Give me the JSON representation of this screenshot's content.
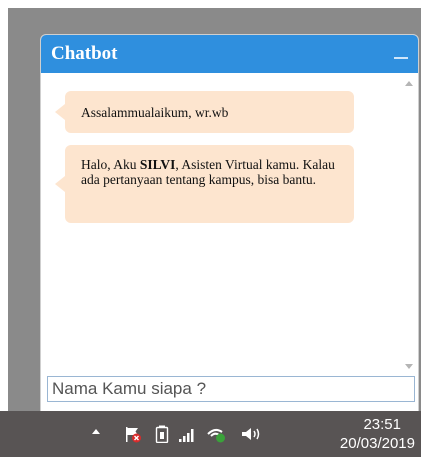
{
  "chatbot": {
    "title": "Chatbot",
    "messages": [
      {
        "text_before": "Assalammualaikum, wr.wb",
        "bold": "",
        "text_after": ""
      },
      {
        "text_before": "Halo, Aku ",
        "bold": "SILVI",
        "text_after": ", Asisten Virtual kamu. Kalau ada pertanyaan tentang kampus, bisa bantu."
      }
    ],
    "input": {
      "value": "",
      "placeholder": "Nama Kamu siapa ?"
    }
  },
  "taskbar": {
    "time": "23:51",
    "date": "20/03/2019",
    "icons": [
      "show-hidden-icons-icon",
      "action-center-flag-icon",
      "battery-icon",
      "signal-icon",
      "network-icon",
      "volume-icon"
    ]
  },
  "colors": {
    "header": "#2f8fde",
    "bubble": "#fde5cf",
    "taskbar": "#585454",
    "background": "#8a8a8a"
  }
}
